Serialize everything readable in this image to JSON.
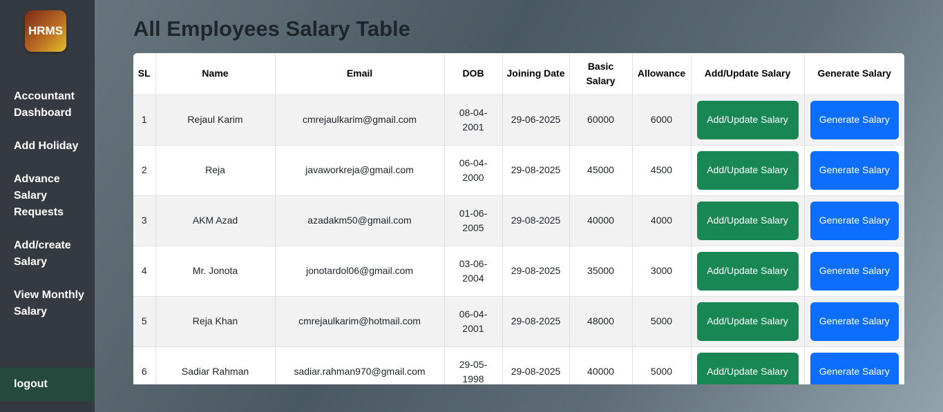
{
  "sidebar": {
    "logo": "HRMS",
    "items": [
      {
        "label": "Accountant Dashboard"
      },
      {
        "label": "Add Holiday"
      },
      {
        "label": "Advance Salary Requests"
      },
      {
        "label": "Add/create Salary"
      },
      {
        "label": "View Monthly Salary"
      }
    ],
    "logout": "logout"
  },
  "page": {
    "title": "All Employees Salary Table"
  },
  "table": {
    "headers": [
      "SL",
      "Name",
      "Email",
      "DOB",
      "Joining Date",
      "Basic Salary",
      "Allowance",
      "Add/Update Salary",
      "Generate Salary"
    ],
    "rows": [
      {
        "sl": "1",
        "name": "Rejaul Karim",
        "email": "cmrejaulkarim@gmail.com",
        "dob": "08-04-2001",
        "joining": "29-06-2025",
        "basic": "60000",
        "allowance": "6000",
        "add_label": "Add/Update Salary",
        "gen_label": "Generate Salary"
      },
      {
        "sl": "2",
        "name": "Reja",
        "email": "javaworkreja@gmail.com",
        "dob": "06-04-2000",
        "joining": "29-08-2025",
        "basic": "45000",
        "allowance": "4500",
        "add_label": "Add/Update Salary",
        "gen_label": "Generate Salary"
      },
      {
        "sl": "3",
        "name": "AKM Azad",
        "email": "azadakm50@gmail.com",
        "dob": "01-06-2005",
        "joining": "29-08-2025",
        "basic": "40000",
        "allowance": "4000",
        "add_label": "Add/Update Salary",
        "gen_label": "Generate Salary"
      },
      {
        "sl": "4",
        "name": "Mr. Jonota",
        "email": "jonotardol06@gmail.com",
        "dob": "03-06-2004",
        "joining": "29-08-2025",
        "basic": "35000",
        "allowance": "3000",
        "add_label": "Add/Update Salary",
        "gen_label": "Generate Salary"
      },
      {
        "sl": "5",
        "name": "Reja Khan",
        "email": "cmrejaulkarim@hotmail.com",
        "dob": "06-04-2001",
        "joining": "29-08-2025",
        "basic": "48000",
        "allowance": "5000",
        "add_label": "Add/Update Salary",
        "gen_label": "Generate Salary"
      },
      {
        "sl": "6",
        "name": "Sadiar Rahman",
        "email": "sadiar.rahman970@gmail.com",
        "dob": "29-05-1998",
        "joining": "29-08-2025",
        "basic": "40000",
        "allowance": "5000",
        "add_label": "Add/Update Salary",
        "gen_label": "Generate Salary"
      }
    ]
  },
  "colors": {
    "sidebar_bg": "#343a40",
    "logout_bg": "#254a3d",
    "add_button": "#198754",
    "generate_button": "#0d6efd"
  }
}
